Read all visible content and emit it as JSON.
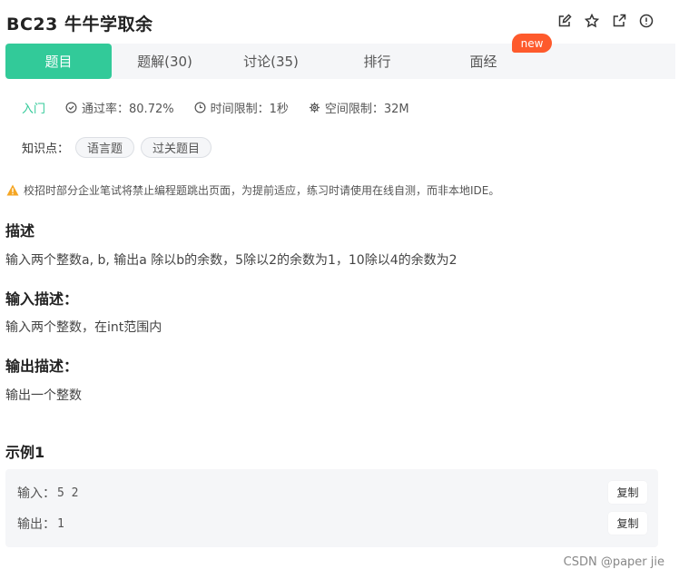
{
  "problem": {
    "title": "BC23  牛牛学取余"
  },
  "header": {
    "icons": [
      "edit-icon",
      "star-icon",
      "share-icon",
      "report-icon"
    ]
  },
  "tabs": [
    {
      "label": "题目",
      "active": true
    },
    {
      "label": "题解(30)",
      "active": false
    },
    {
      "label": "讨论(35)",
      "active": false
    },
    {
      "label": "排行",
      "active": false
    },
    {
      "label": "面经",
      "active": false
    }
  ],
  "new_badge": "new",
  "meta": {
    "difficulty": "入门",
    "pass_rate": "通过率：80.72%",
    "time_limit": "时间限制：1秒",
    "space_limit": "空间限制：32M"
  },
  "knowledge": {
    "label": "知识点：",
    "tags": [
      "语言题",
      "过关题目"
    ]
  },
  "warning": "校招时部分企业笔试将禁止编程题跳出页面，为提前适应，练习时请使用在线自测，而非本地IDE。",
  "description": {
    "heading": "描述",
    "text": "输入两个整数a, b, 输出a 除以b的余数，5除以2的余数为1，10除以4的余数为2"
  },
  "input_desc": {
    "heading": "输入描述：",
    "text": "输入两个整数，在int范围内"
  },
  "output_desc": {
    "heading": "输出描述：",
    "text": "输出一个整数"
  },
  "example": {
    "heading": "示例1",
    "input_label": "输入：",
    "input_value": "5 2",
    "output_label": "输出：",
    "output_value": "1",
    "copy_label": "复制"
  },
  "colors": {
    "accent": "#32ca99",
    "badge": "#fe5a2c",
    "warning": "#f5a623"
  },
  "watermark": "CSDN @paper jie"
}
